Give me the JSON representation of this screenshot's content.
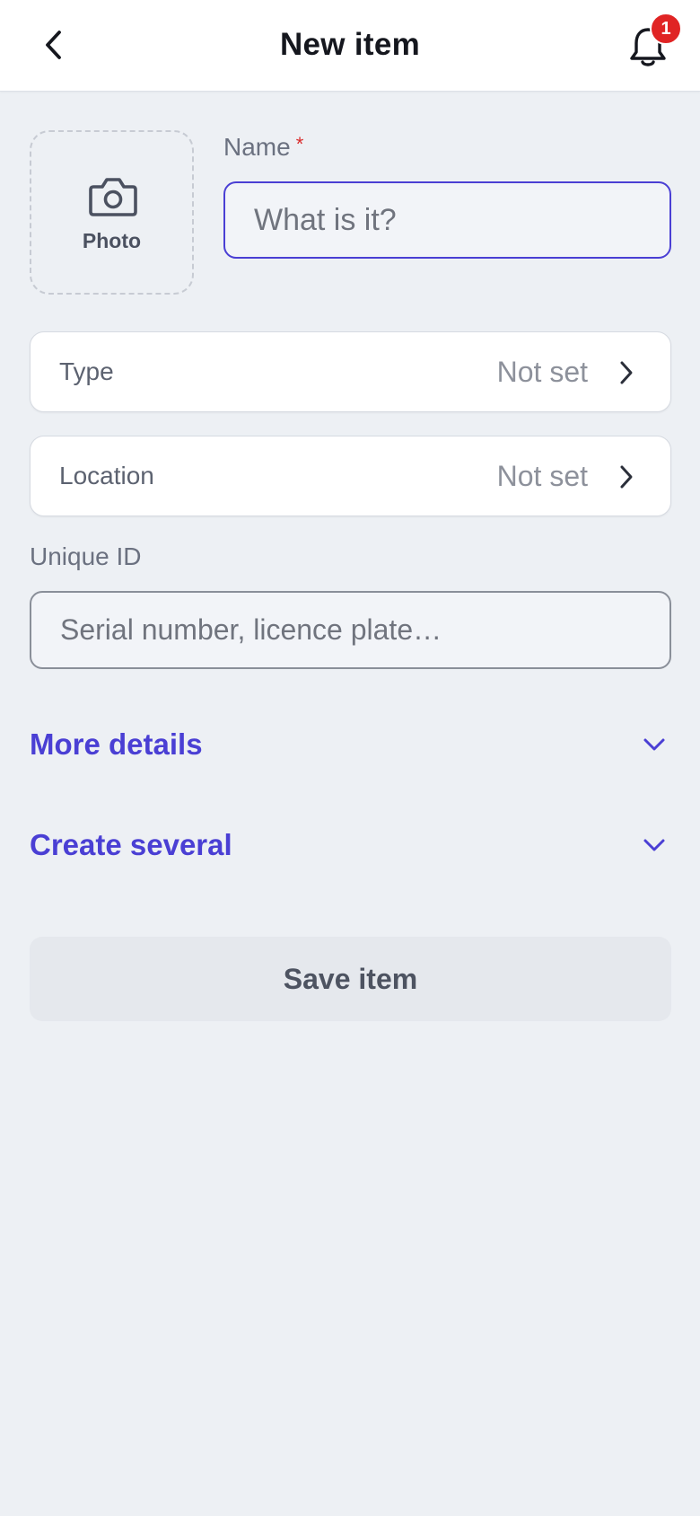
{
  "header": {
    "title": "New item",
    "back_icon": "chevron-left-icon",
    "bell_icon": "bell-icon",
    "notification_count": "1"
  },
  "photo": {
    "label": "Photo",
    "icon": "camera-icon"
  },
  "name_field": {
    "label": "Name",
    "required_mark": "*",
    "placeholder": "What is it?",
    "value": ""
  },
  "type_row": {
    "label": "Type",
    "value": "Not set"
  },
  "location_row": {
    "label": "Location",
    "value": "Not set"
  },
  "unique_id_field": {
    "label": "Unique ID",
    "placeholder": "Serial number, licence plate…",
    "value": ""
  },
  "more_details": {
    "label": "More details"
  },
  "create_several": {
    "label": "Create several"
  },
  "save_button": {
    "label": "Save item"
  },
  "colors": {
    "accent": "#4a3fd4",
    "badge": "#e02424",
    "background": "#edf0f4"
  }
}
